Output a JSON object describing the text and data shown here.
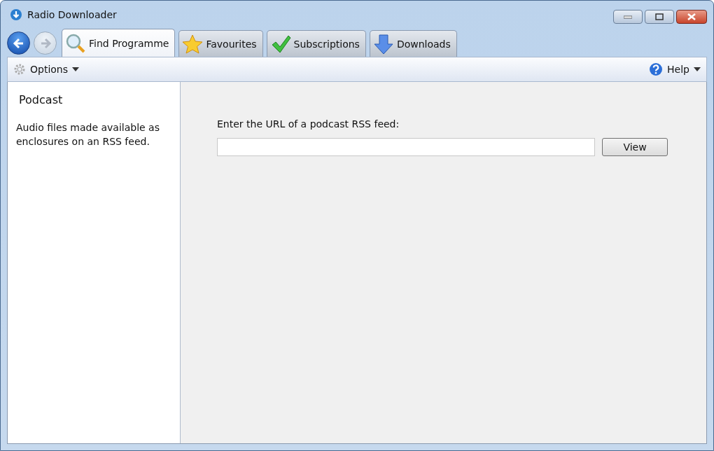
{
  "window": {
    "title": "Radio Downloader"
  },
  "nav": [
    {
      "kind": "back",
      "disabled": false
    },
    {
      "kind": "forward",
      "disabled": true
    }
  ],
  "tabs": [
    {
      "label": "Find Programme",
      "kind": "search",
      "selected": true
    },
    {
      "label": "Favourites",
      "kind": "star",
      "selected": false
    },
    {
      "label": "Subscriptions",
      "kind": "check",
      "selected": false
    },
    {
      "label": "Downloads",
      "kind": "download",
      "selected": false
    }
  ],
  "toolbar": {
    "options": "Options",
    "help": "Help"
  },
  "sidebar": {
    "title": "Podcast",
    "description": "Audio files made available as enclosures on an RSS feed."
  },
  "main": {
    "label": "Enter the URL of a podcast RSS feed:",
    "button": "View"
  }
}
